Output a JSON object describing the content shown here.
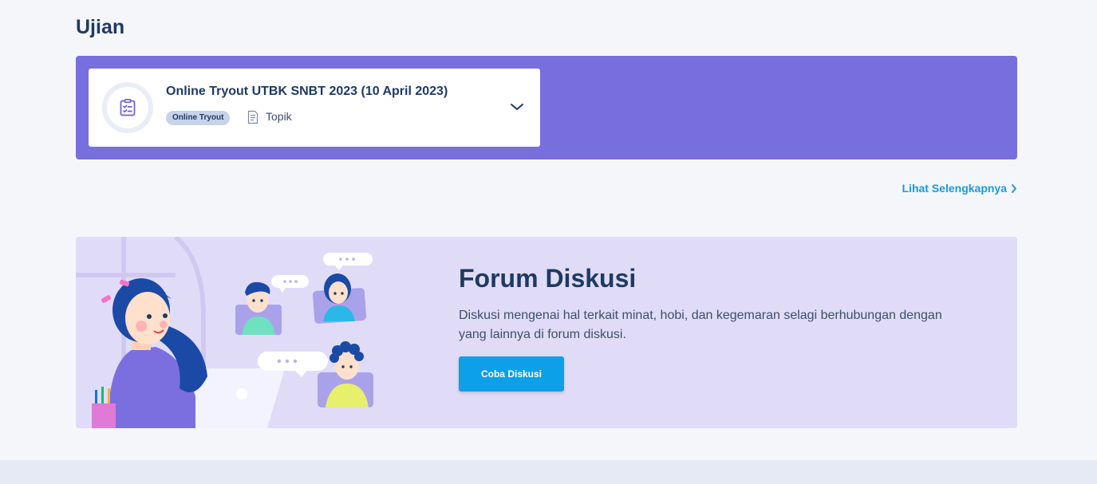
{
  "exam_section": {
    "title": "Ujian",
    "panel_color": "#776fde",
    "card": {
      "icon": "clipboard-checklist-icon",
      "title": "Online Tryout UTBK SNBT 2023 (10 April 2023)",
      "badge": "Online Tryout",
      "topic_icon": "document-icon",
      "topic_label": "Topik",
      "expand_icon": "chevron-down-icon"
    },
    "see_more": {
      "label": "Lihat Selengkapnya",
      "icon": "chevron-right-icon",
      "color": "#1a9ad6"
    }
  },
  "forum_banner": {
    "title": "Forum Diskusi",
    "description": "Diskusi mengenai hal terkait minat, hobi, dan kegemaran selagi berhubungan dengan yang lainnya di forum diskusi.",
    "button_label": "Coba Diskusi",
    "button_color": "#0ca0e8",
    "background_color": "#e0dcf8"
  }
}
